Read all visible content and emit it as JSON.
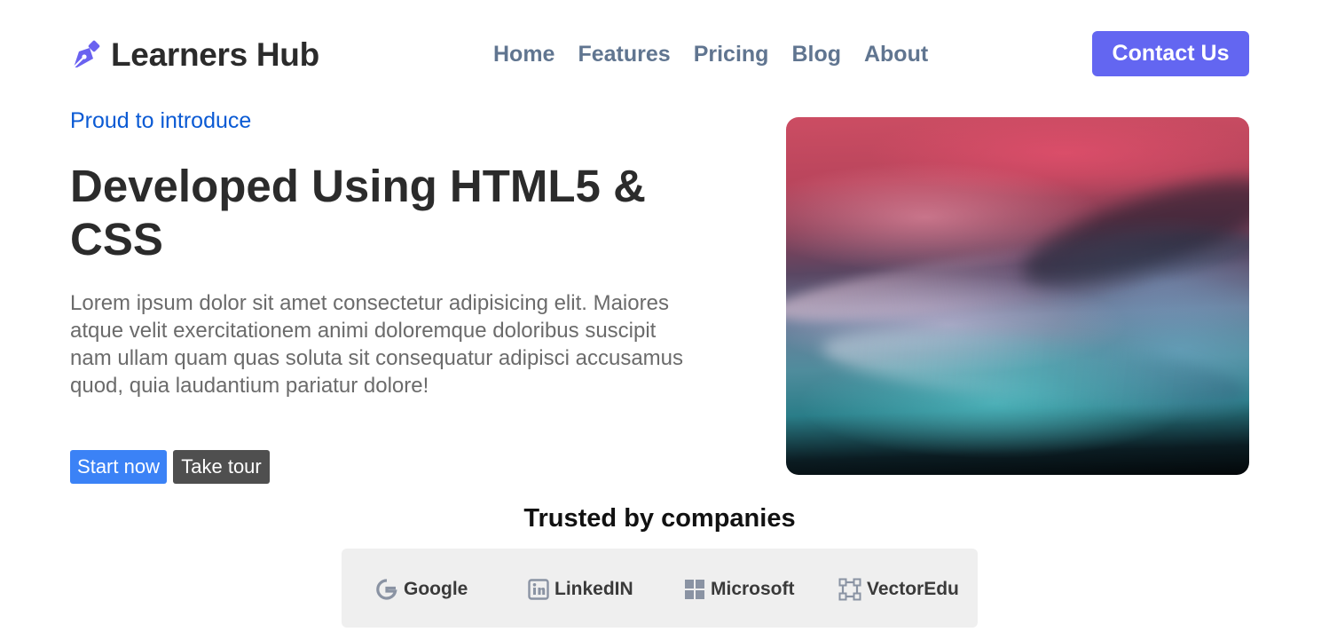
{
  "header": {
    "brand": "Learners Hub",
    "brand_icon": "pen-nib-icon",
    "nav": [
      {
        "label": "Home"
      },
      {
        "label": "Features"
      },
      {
        "label": "Pricing"
      },
      {
        "label": "Blog"
      },
      {
        "label": "About"
      }
    ],
    "cta_label": "Contact Us"
  },
  "hero": {
    "eyebrow": "Proud to introduce",
    "title": "Developed Using HTML5 & CSS",
    "description": "Lorem ipsum dolor sit amet consectetur adipisicing elit. Maiores atque velit exercitationem animi doloremque doloribus suscipit nam ullam quam quas soluta sit consequatur adipisci accusamus quod, quia laudantium pariatur dolore!",
    "primary_button": "Start now",
    "secondary_button": "Take tour"
  },
  "trusted": {
    "title": "Trusted by companies",
    "companies": [
      {
        "name": "Google",
        "icon": "google-icon"
      },
      {
        "name": "LinkedIN",
        "icon": "linkedin-icon"
      },
      {
        "name": "Microsoft",
        "icon": "microsoft-icon"
      },
      {
        "name": "VectorEdu",
        "icon": "vector-square-icon"
      }
    ]
  },
  "colors": {
    "brand_accent": "#6366f1",
    "nav_text": "#607590",
    "eyebrow_text": "#0a5ad4",
    "primary_button": "#3b82f6",
    "secondary_button": "#4f4f4f"
  }
}
